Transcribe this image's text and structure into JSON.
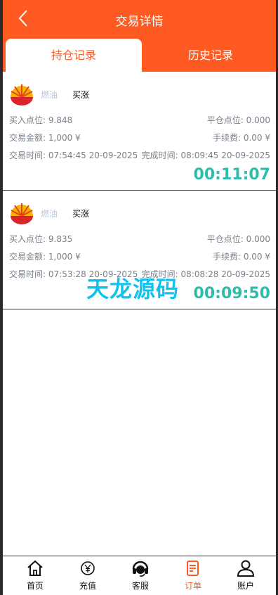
{
  "header": {
    "title": "交易详情",
    "back_icon": "chevron-left-icon"
  },
  "tabs": [
    {
      "label": "持仓记录",
      "active": true
    },
    {
      "label": "历史记录",
      "active": false
    }
  ],
  "labels": {
    "buy_point": "买入点位:",
    "close_point": "平仓点位:",
    "amount": "交易金额:",
    "fee": "手续费:",
    "trade_time": "交易时间:",
    "finish_time": "完成时间:"
  },
  "orders": [
    {
      "product": "燃油",
      "direction": "买涨",
      "buy_point": "9.848",
      "close_point": "0.000",
      "amount": "1,000 ¥",
      "fee": "0.00 ¥",
      "trade_time": "07:54:45 20-09-2025",
      "finish_time": "08:09:45 20-09-2025",
      "countdown": "00:11:07"
    },
    {
      "product": "燃油",
      "direction": "买涨",
      "buy_point": "9.835",
      "close_point": "0.000",
      "amount": "1,000 ¥",
      "fee": "0.00 ¥",
      "trade_time": "07:53:28 20-09-2025",
      "finish_time": "08:08:28 20-09-2025",
      "countdown": "00:09:50"
    }
  ],
  "watermark": "天龙源码",
  "nav": [
    {
      "label": "首页",
      "icon": "home-icon",
      "active": false
    },
    {
      "label": "充值",
      "icon": "yen-coin-icon",
      "active": false
    },
    {
      "label": "客服",
      "icon": "headset-icon",
      "active": false
    },
    {
      "label": "订单",
      "icon": "order-list-icon",
      "active": true
    },
    {
      "label": "账户",
      "icon": "user-icon",
      "active": false
    }
  ],
  "colors": {
    "brand": "#ff5a22",
    "timer": "#2ebcab",
    "watermark": "#12c2ee"
  }
}
